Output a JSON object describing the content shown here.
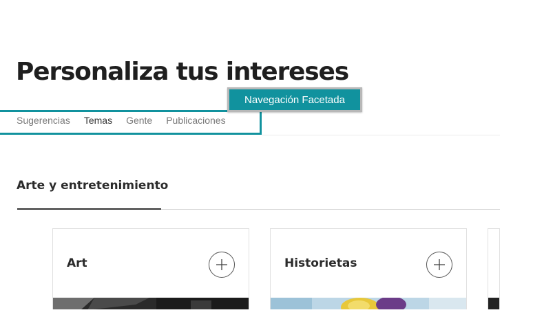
{
  "header": {
    "title": "Personaliza tus intereses"
  },
  "callout": {
    "label": "Navegación Facetada"
  },
  "tabs": [
    {
      "label": "Sugerencias",
      "active": false
    },
    {
      "label": "Temas",
      "active": true
    },
    {
      "label": "Gente",
      "active": false
    },
    {
      "label": "Publicaciones",
      "active": false
    }
  ],
  "section": {
    "title": "Arte y entretenimiento"
  },
  "cards": [
    {
      "title": "Art",
      "follow_icon": "plus-icon"
    },
    {
      "title": "Historietas",
      "follow_icon": "plus-icon"
    }
  ],
  "colors": {
    "accent": "#11929e"
  }
}
